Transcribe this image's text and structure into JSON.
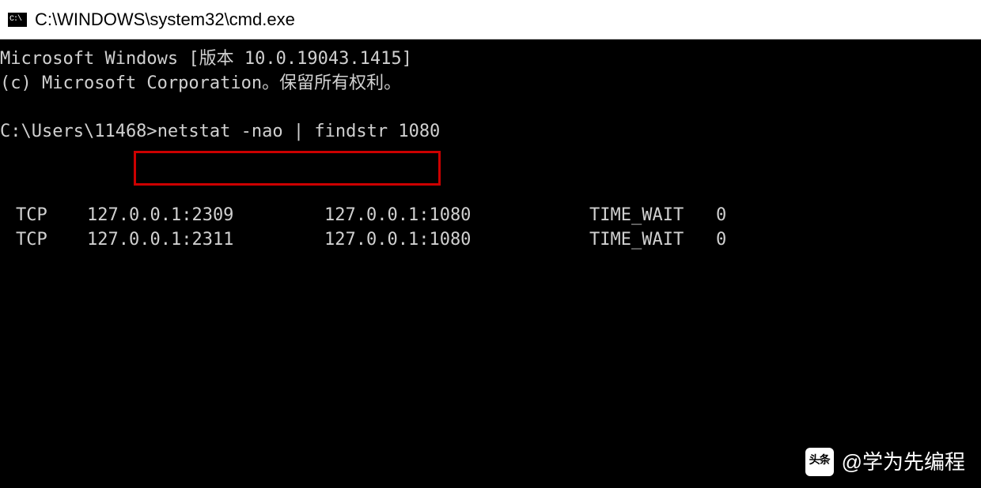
{
  "window": {
    "title": "C:\\WINDOWS\\system32\\cmd.exe"
  },
  "terminal": {
    "header1": "Microsoft Windows [版本 10.0.19043.1415]",
    "header2": "(c) Microsoft Corporation。保留所有权利。",
    "prompt": "C:\\Users\\11468>",
    "command": "netstat -nao | findstr 1080",
    "rows": [
      {
        "proto": "TCP",
        "local": "127.0.0.1:2309",
        "remote": "127.0.0.1:1080",
        "state": "TIME_WAIT",
        "pid": "0"
      },
      {
        "proto": "TCP",
        "local": "127.0.0.1:2311",
        "remote": "127.0.0.1:1080",
        "state": "TIME_WAIT",
        "pid": "0"
      }
    ]
  },
  "watermark": {
    "label": "头条",
    "handle": "@学为先编程"
  }
}
